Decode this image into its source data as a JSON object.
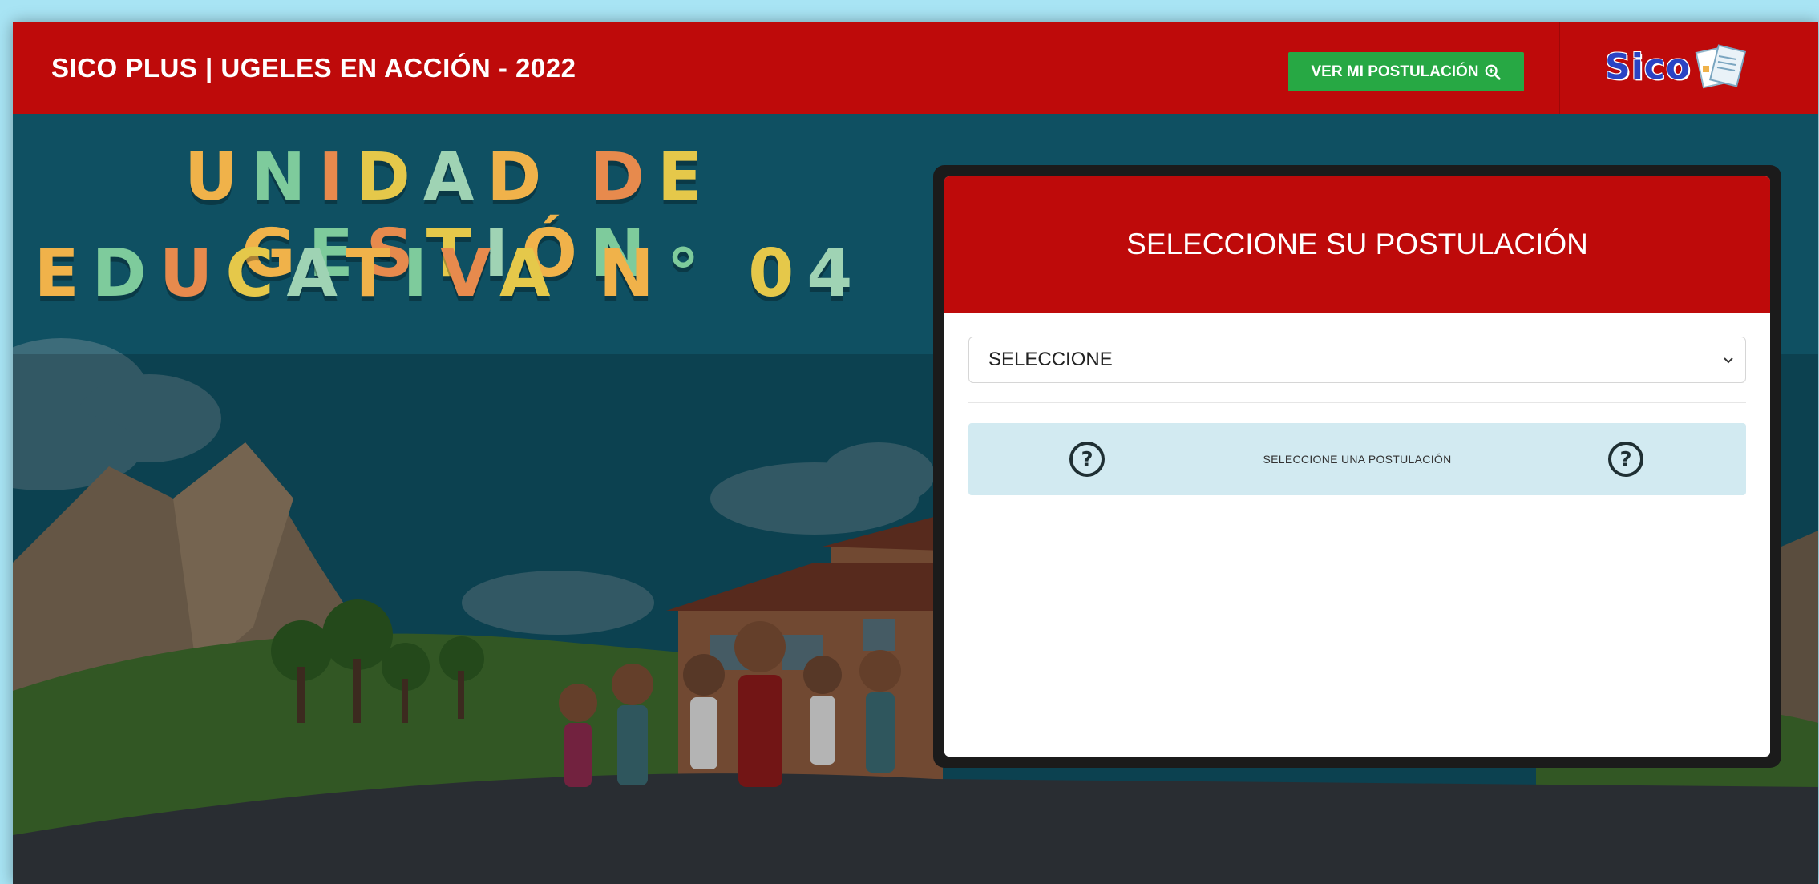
{
  "header": {
    "title": "SICO PLUS | UGELES EN ACCIÓN - 2022",
    "ver_button": "VER MI POSTULACIÓN",
    "logo_text": "Sico",
    "colors": {
      "bar": "#be0a0a",
      "button": "#27a844"
    }
  },
  "hero": {
    "line1": "UNIDAD DE GESTIÓN",
    "line2": "EDUCATIVA N° 04"
  },
  "panel": {
    "title": "SELECCIONE SU POSTULACIÓN",
    "select_value": "SELECCIONE",
    "info_text": "SELECCIONE UNA POSTULACIÓN",
    "info_icon": "question-circle-icon"
  }
}
